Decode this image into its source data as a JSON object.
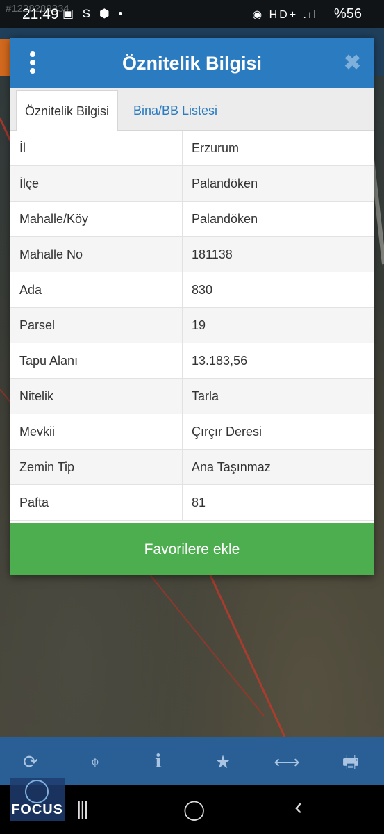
{
  "status": {
    "time": "21:49",
    "left_icons": "▣ S ⬢ •",
    "system": "◉ HD+ .ıl",
    "battery": "%56",
    "watermark": "#1228289334"
  },
  "dialog": {
    "title": "Öznitelik Bilgisi",
    "close_glyph": "✖",
    "tabs": [
      {
        "label": "Öznitelik Bilgisi",
        "active": true
      },
      {
        "label": "Bina/BB Listesi",
        "active": false
      }
    ],
    "rows": [
      {
        "key": "İl",
        "value": "Erzurum"
      },
      {
        "key": "İlçe",
        "value": "Palandöken"
      },
      {
        "key": "Mahalle/Köy",
        "value": "Palandöken"
      },
      {
        "key": "Mahalle No",
        "value": "181138"
      },
      {
        "key": "Ada",
        "value": "830"
      },
      {
        "key": "Parsel",
        "value": "19"
      },
      {
        "key": "Tapu Alanı",
        "value": "13.183,56"
      },
      {
        "key": "Nitelik",
        "value": "Tarla"
      },
      {
        "key": "Mevkii",
        "value": "Çırçır Deresi"
      },
      {
        "key": "Zemin Tip",
        "value": "Ana Taşınmaz"
      },
      {
        "key": "Pafta",
        "value": "81"
      }
    ],
    "favorite_button": "Favorilere ekle"
  },
  "toolbar": {
    "refresh": "⟳",
    "locate": "⌖",
    "info": "i",
    "favorite": "★",
    "measure": "⟷",
    "print": "🖶"
  },
  "navbar": {
    "recents": "|||",
    "home": "◯",
    "back": "‹"
  },
  "logo": {
    "text": "FOCUS"
  },
  "colors": {
    "header_blue": "#2a7bc0",
    "button_green": "#4cae4f",
    "toolbar_blue": "#2a5f96"
  }
}
